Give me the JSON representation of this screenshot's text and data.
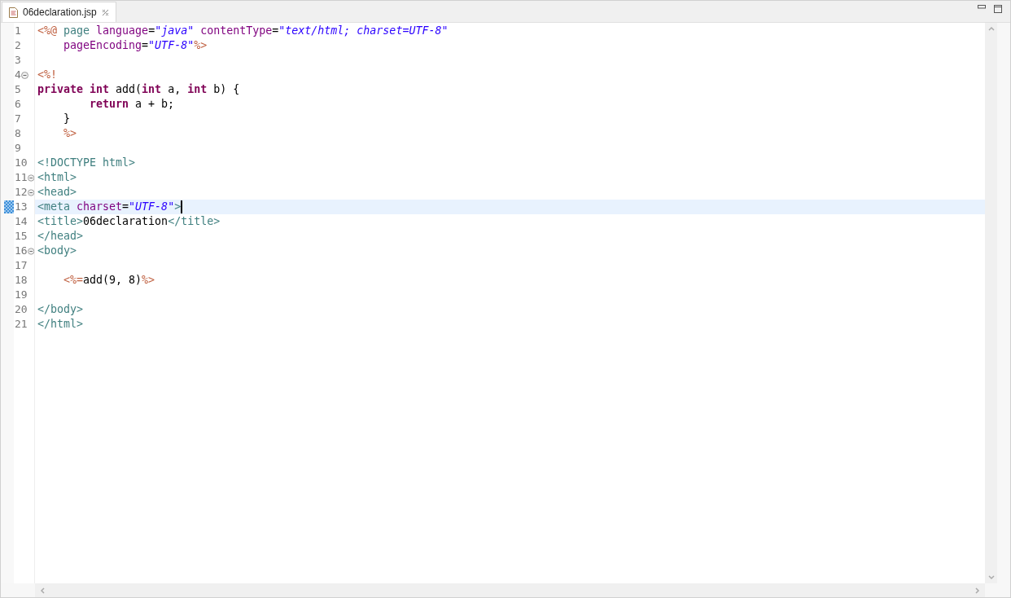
{
  "tab": {
    "title": "06declaration.jsp",
    "selected": true
  },
  "lines": [
    {
      "number": "1",
      "foldable": false,
      "current": false,
      "tokens": [
        {
          "kind": "jsp",
          "text": "<%@"
        },
        {
          "kind": "tag",
          "text": " page"
        },
        {
          "kind": "attr",
          "text": " language"
        },
        {
          "kind": "plain",
          "text": "="
        },
        {
          "kind": "value",
          "text": "\"java\""
        },
        {
          "kind": "attr",
          "text": " contentType"
        },
        {
          "kind": "plain",
          "text": "="
        },
        {
          "kind": "value",
          "text": "\"text/html; charset=UTF-8\""
        }
      ]
    },
    {
      "number": "2",
      "foldable": false,
      "current": false,
      "tokens": [
        {
          "kind": "attr",
          "text": "    pageEncoding"
        },
        {
          "kind": "plain",
          "text": "="
        },
        {
          "kind": "value",
          "text": "\"UTF-8\""
        },
        {
          "kind": "jsp",
          "text": "%>"
        }
      ]
    },
    {
      "number": "3",
      "foldable": false,
      "current": false
    },
    {
      "number": "4",
      "foldable": true,
      "current": false,
      "tokens": [
        {
          "kind": "jsp",
          "text": "<%!"
        }
      ]
    },
    {
      "number": "5",
      "foldable": false,
      "current": false,
      "tokens": [
        {
          "kind": "keyword",
          "text": "private int"
        },
        {
          "kind": "plain",
          "text": " add("
        },
        {
          "kind": "keyword",
          "text": "int"
        },
        {
          "kind": "plain",
          "text": " a, "
        },
        {
          "kind": "keyword",
          "text": "int"
        },
        {
          "kind": "plain",
          "text": " b) {"
        }
      ]
    },
    {
      "number": "6",
      "foldable": false,
      "current": false,
      "tokens": [
        {
          "kind": "keyword",
          "text": "        return"
        },
        {
          "kind": "plain",
          "text": " a + b;"
        }
      ]
    },
    {
      "number": "7",
      "foldable": false,
      "current": false,
      "tokens": [
        {
          "kind": "plain",
          "text": "    }"
        }
      ]
    },
    {
      "number": "8",
      "foldable": false,
      "current": false,
      "tokens": [
        {
          "kind": "jsp",
          "text": "    %>"
        }
      ]
    },
    {
      "number": "9",
      "foldable": false,
      "current": false
    },
    {
      "number": "10",
      "foldable": false,
      "current": false,
      "tokens": [
        {
          "kind": "tag",
          "text": "<!DOCTYPE html>"
        }
      ]
    },
    {
      "number": "11",
      "foldable": true,
      "current": false,
      "tokens": [
        {
          "kind": "tag",
          "text": "<html>"
        }
      ]
    },
    {
      "number": "12",
      "foldable": true,
      "current": false,
      "tokens": [
        {
          "kind": "tag",
          "text": "<head>"
        }
      ]
    },
    {
      "number": "13",
      "foldable": false,
      "current": true,
      "tokens": [
        {
          "kind": "tag",
          "text": "<meta"
        },
        {
          "kind": "attr",
          "text": " charset"
        },
        {
          "kind": "plain",
          "text": "="
        },
        {
          "kind": "value",
          "text": "\"UTF-8\""
        },
        {
          "kind": "tag",
          "text": ">"
        }
      ]
    },
    {
      "number": "14",
      "foldable": false,
      "current": false,
      "tokens": [
        {
          "kind": "tag",
          "text": "<title>"
        },
        {
          "kind": "plain",
          "text": "06declaration"
        },
        {
          "kind": "tag",
          "text": "</title>"
        }
      ]
    },
    {
      "number": "15",
      "foldable": false,
      "current": false,
      "tokens": [
        {
          "kind": "tag",
          "text": "</head>"
        }
      ]
    },
    {
      "number": "16",
      "foldable": true,
      "current": false,
      "tokens": [
        {
          "kind": "tag",
          "text": "<body>"
        }
      ]
    },
    {
      "number": "17",
      "foldable": false,
      "current": false
    },
    {
      "number": "18",
      "foldable": false,
      "current": false,
      "tokens": [
        {
          "kind": "jsp",
          "text": "    <%="
        },
        {
          "kind": "plain",
          "text": "add(9, 8)"
        },
        {
          "kind": "jsp",
          "text": "%>"
        }
      ]
    },
    {
      "number": "19",
      "foldable": false,
      "current": false
    },
    {
      "number": "20",
      "foldable": false,
      "current": false,
      "tokens": [
        {
          "kind": "tag",
          "text": "</body>"
        }
      ]
    },
    {
      "number": "21",
      "foldable": false,
      "current": false,
      "tokens": [
        {
          "kind": "tag",
          "text": "</html>"
        }
      ]
    }
  ]
}
